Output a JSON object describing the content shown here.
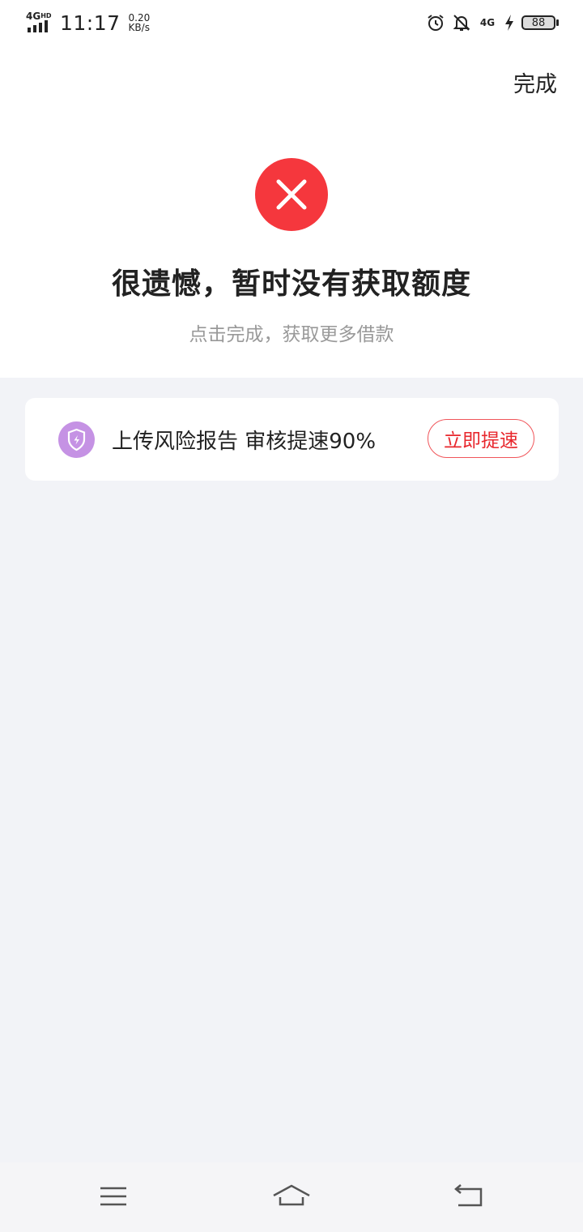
{
  "status_bar": {
    "network_left": "4G",
    "network_hd": "HD",
    "time": "11:17",
    "speed_value": "0.20",
    "speed_unit": "KB/s",
    "network_right": "4G",
    "battery": "88",
    "icons": [
      "alarm-icon",
      "bell-off-icon",
      "signal-4g-icon",
      "charging-icon",
      "battery-icon"
    ]
  },
  "header": {
    "done_label": "完成"
  },
  "result": {
    "status_color": "#f5373d",
    "title": "很遗憾，暂时没有获取额度",
    "subtitle": "点击完成，获取更多借款"
  },
  "promo": {
    "text": "上传风险报告 审核提速90%",
    "button_label": "立即提速",
    "accent": "#e8272d",
    "icon_color": "#c592e4"
  },
  "nav": {
    "icons": [
      "menu-icon",
      "home-icon",
      "back-icon"
    ]
  }
}
